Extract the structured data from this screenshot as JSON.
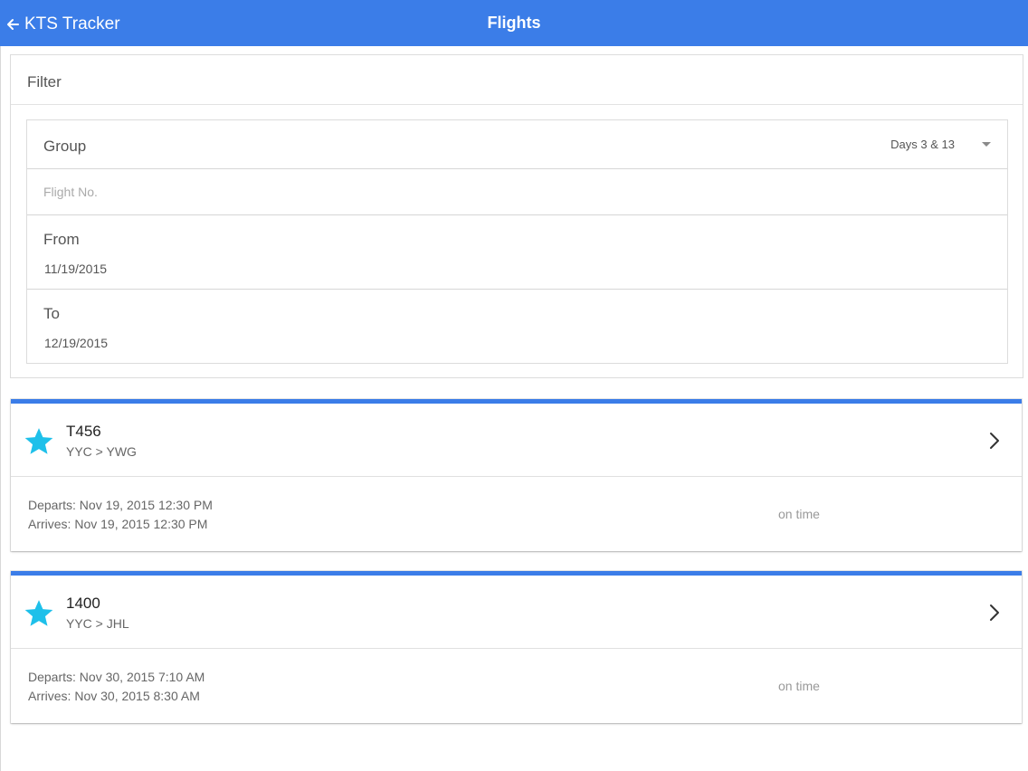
{
  "header": {
    "back_label": "KTS Tracker",
    "title": "Flights"
  },
  "filter": {
    "heading": "Filter",
    "group_label": "Group",
    "group_value": "Days 3 & 13",
    "flight_placeholder": "Flight No.",
    "from_label": "From",
    "from_value": "11/19/2015",
    "to_label": "To",
    "to_value": "12/19/2015"
  },
  "flights": [
    {
      "number": "T456",
      "route": "YYC > YWG",
      "departs": "Departs: Nov 19, 2015 12:30 PM",
      "arrives": "Arrives: Nov 19, 2015 12:30 PM",
      "status": "on time"
    },
    {
      "number": "1400",
      "route": "YYC > JHL",
      "departs": "Departs: Nov 30, 2015 7:10 AM",
      "arrives": "Arrives: Nov 30, 2015 8:30 AM",
      "status": "on time"
    }
  ],
  "colors": {
    "accent": "#3b7de8",
    "star": "#1ec0ea"
  },
  "icons": {
    "back": "arrow-left-icon",
    "dropdown": "caret-down-icon",
    "favorite": "star-icon",
    "open": "chevron-right-icon"
  }
}
